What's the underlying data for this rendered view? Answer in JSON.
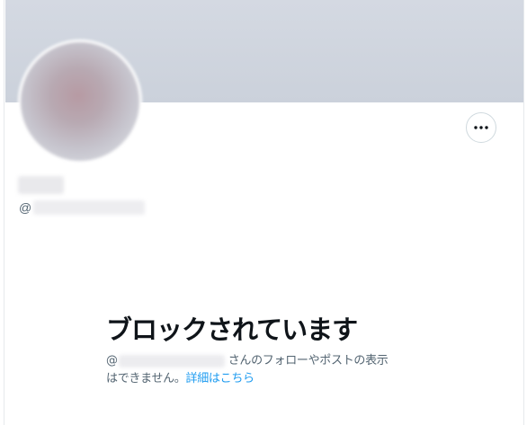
{
  "profile": {
    "handle_prefix": "@",
    "more_button_icon": "more-horizontal-icon"
  },
  "blocked": {
    "title": "ブロックされています",
    "at_prefix": "@",
    "desc_line1": "さんのフォローやポストの表示",
    "desc_line2": "はできません。",
    "learn_more_label": "詳細はこちら"
  },
  "colors": {
    "banner": "#cbd1db",
    "title_text": "#0f1419",
    "secondary_text": "#536471",
    "link": "#1d9bf0",
    "button_border": "#cfd9de"
  }
}
